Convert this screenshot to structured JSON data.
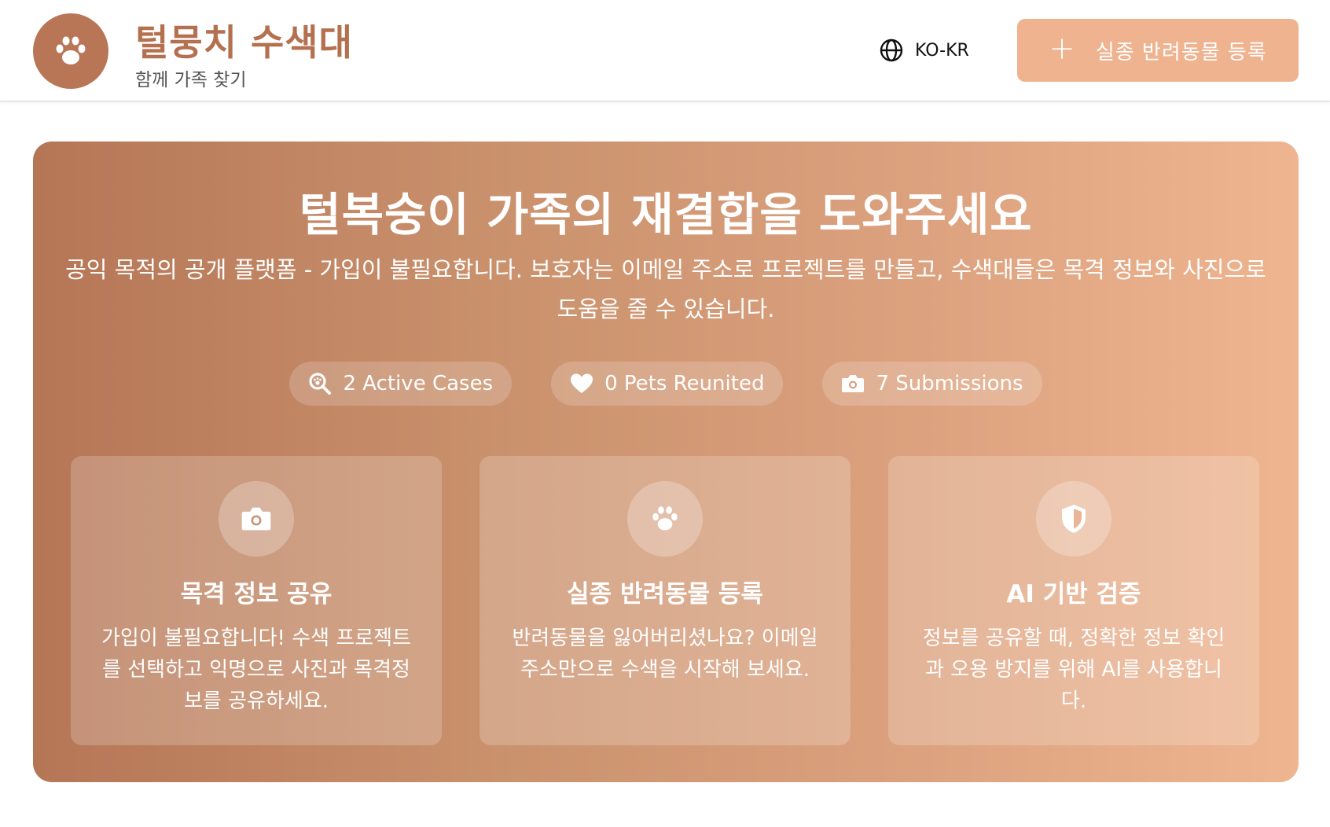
{
  "header": {
    "title": "털뭉치 수색대",
    "subtitle": "함께 가족 찾기",
    "language": "KO-KR",
    "register_button": "실종 반려동물 등록"
  },
  "hero": {
    "title": "털복숭이 가족의 재결합을 도와주세요",
    "description": "공익 목적의 공개 플랫폼 - 가입이 불필요합니다. 보호자는 이메일 주소로 프로젝트를 만들고, 수색대들은 목격 정보와 사진으로 도움을 줄 수 있습니다.",
    "stats": [
      {
        "icon": "search-paw-icon",
        "label": "2 Active Cases"
      },
      {
        "icon": "heart-icon",
        "label": "0 Pets Reunited"
      },
      {
        "icon": "camera-icon",
        "label": "7 Submissions"
      }
    ],
    "cards": [
      {
        "icon": "camera-icon",
        "title": "목격 정보 공유",
        "description": "가입이 불필요합니다! 수색 프로젝트를 선택하고 익명으로 사진과 목격정보를 공유하세요."
      },
      {
        "icon": "paw-icon",
        "title": "실종 반려동물 등록",
        "description": "반려동물을 잃어버리셨나요? 이메일 주소만으로 수색을 시작해 보세요."
      },
      {
        "icon": "shield-icon",
        "title": "AI 기반 검증",
        "description": "정보를 공유할 때, 정확한 정보 확인과 오용 방지를 위해 AI를 사용합니다."
      }
    ]
  },
  "colors": {
    "brand": "#b5714f",
    "button": "#efb38f",
    "hero_start": "#b57656",
    "hero_end": "#efb590"
  }
}
